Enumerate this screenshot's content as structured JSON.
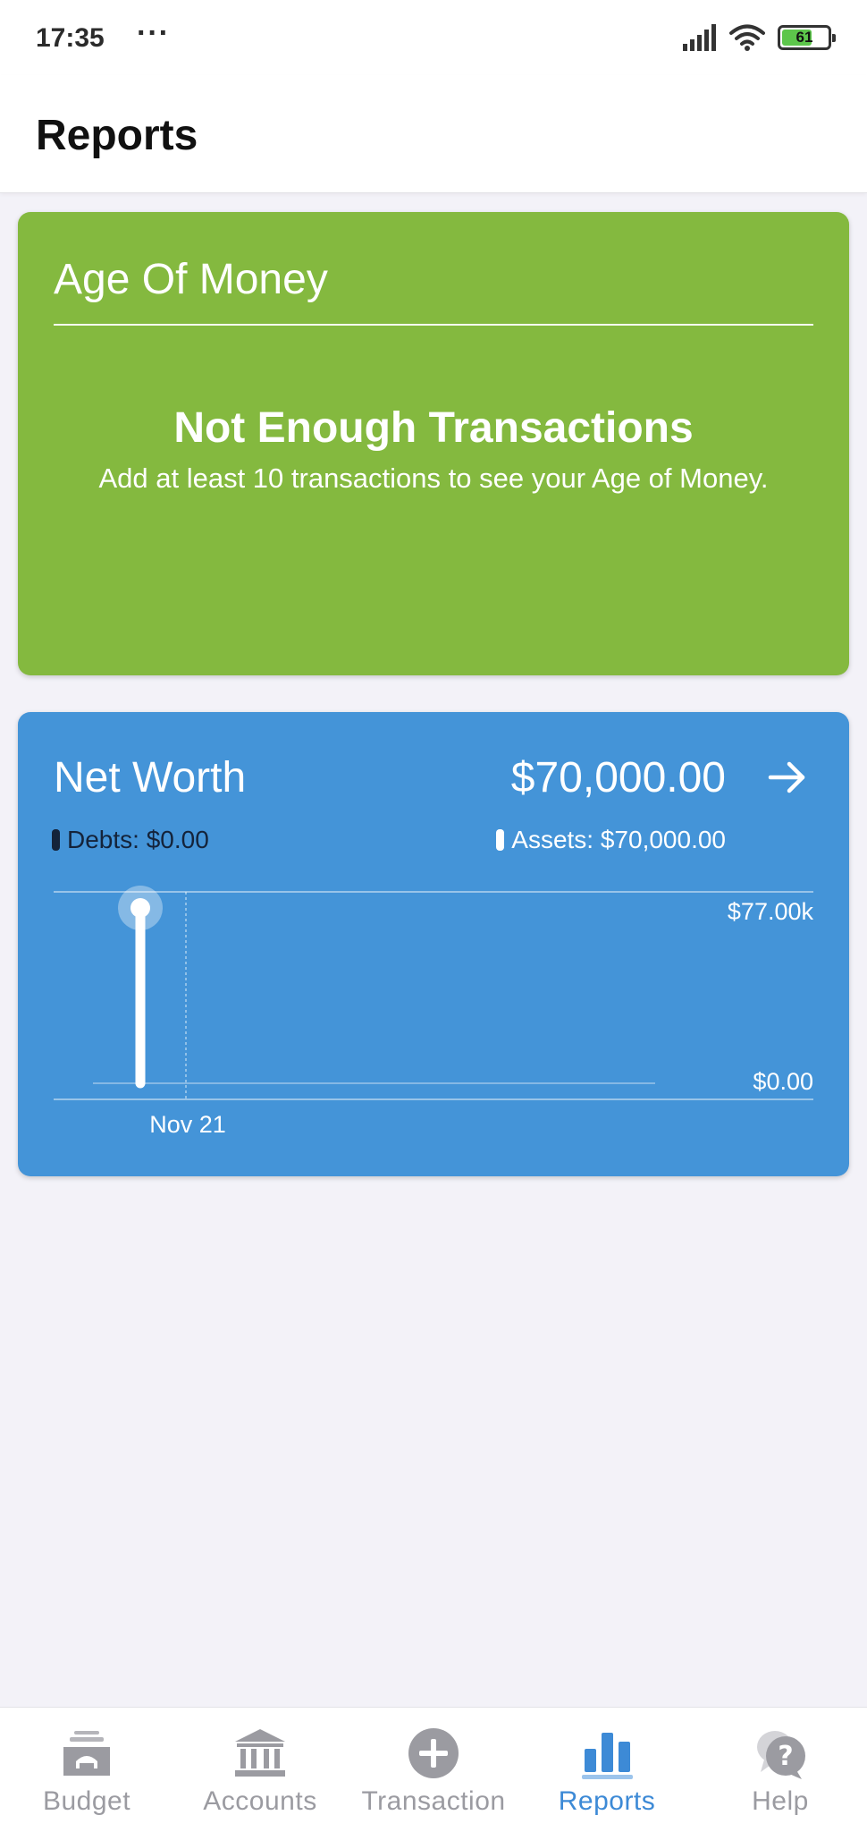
{
  "status_bar": {
    "time": "17:35",
    "dots": "···",
    "battery": "61",
    "battery_color": "#5dc64b"
  },
  "header": {
    "title": "Reports"
  },
  "age_of_money": {
    "title": "Age Of Money",
    "empty_title": "Not Enough Transactions",
    "empty_text": "Add at least 10 transactions to see your Age of Money.",
    "color": "#84b93f"
  },
  "net_worth": {
    "title": "Net Worth",
    "value": "$70,000.00",
    "arrow_icon": "arrow-right-icon",
    "debts_label": "Debts: $0.00",
    "assets_label": "Assets: $70,000.00",
    "color": "#4494d8"
  },
  "chart_data": {
    "type": "bar",
    "categories": [
      "Nov 21"
    ],
    "series": [
      {
        "name": "Debts",
        "values": [
          0
        ]
      },
      {
        "name": "Assets",
        "values": [
          70000
        ]
      }
    ],
    "y_tick_labels": [
      "$77.00k",
      "$0.00"
    ],
    "ylim": [
      0,
      77000
    ],
    "x_tick_labels": [
      "Nov 21"
    ],
    "grid": true
  },
  "bottom_nav": {
    "items": [
      {
        "label": "Budget",
        "icon": "budget-icon",
        "active": false
      },
      {
        "label": "Accounts",
        "icon": "bank-icon",
        "active": false
      },
      {
        "label": "Transaction",
        "icon": "plus-circle-icon",
        "active": false
      },
      {
        "label": "Reports",
        "icon": "bar-chart-icon",
        "active": true
      },
      {
        "label": "Help",
        "icon": "help-bubble-icon",
        "active": false
      }
    ],
    "active_color": "#3d8ad6",
    "inactive_color": "#9b9ba1"
  }
}
